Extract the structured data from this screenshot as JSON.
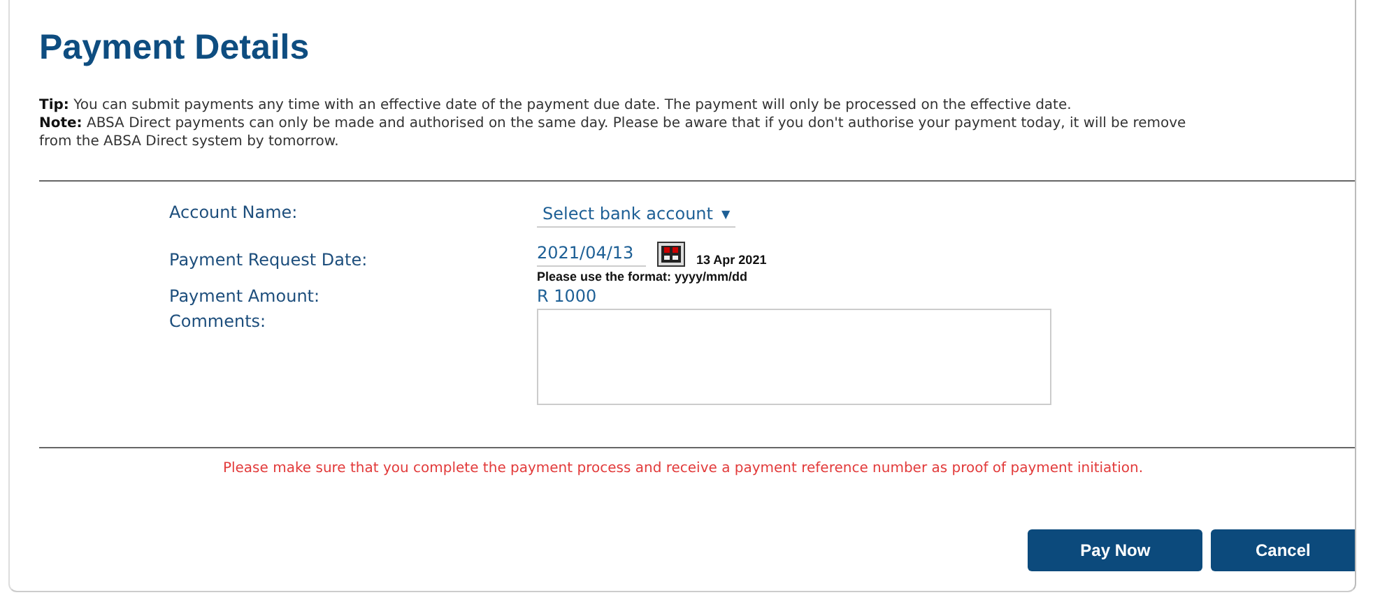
{
  "title": "Payment Details",
  "tip": "**Tip:** You can submit payments any time with an effective date of the payment due date. The payment will only be processed on the effective date.",
  "note_lines": [
    "**Note:** ABSA Direct payments can only be made and authorised on the same day. Please be aware that if you don't authorise your payment today, it will be remove",
    "from the ABSA Direct system by tomorrow."
  ],
  "form": {
    "account_name": {
      "label": "Account Name:",
      "value": "Select bank account",
      "caret": "▼"
    },
    "request_date": {
      "label": "Payment Request Date:",
      "value": "2021/04/13",
      "display": "13 Apr 2021",
      "hint": "Please use the format: yyyy/mm/dd"
    },
    "amount": {
      "label": "Payment Amount:",
      "value": "R 1000"
    },
    "comments": {
      "label": "Comments:"
    }
  },
  "warning": "Please make sure that you complete the payment process and receive a payment reference number as proof of payment initiation.",
  "buttons": [
    {
      "label": "Pay Now"
    },
    {
      "label": "Cancel"
    }
  ]
}
